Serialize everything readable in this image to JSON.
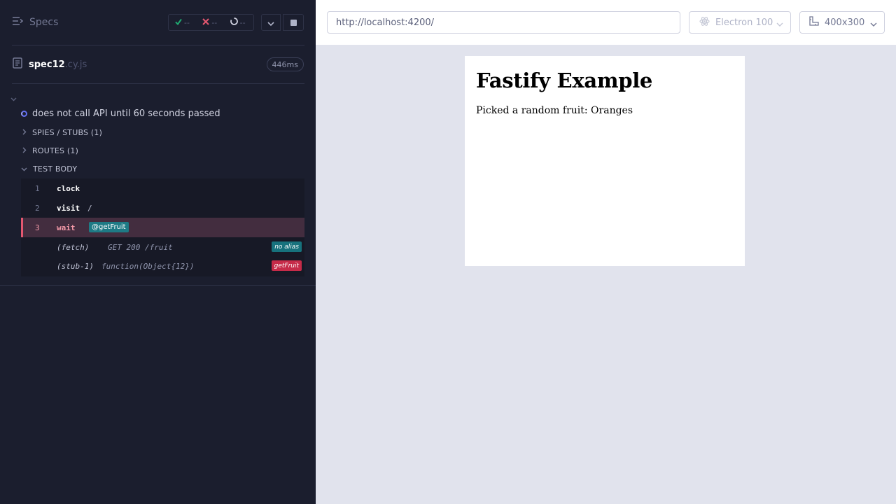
{
  "reporter": {
    "specs_label": "Specs",
    "stats": {
      "passed": "--",
      "failed": "--",
      "pending": "--"
    },
    "spec": {
      "name": "spec12",
      "ext": ".cy.js",
      "duration": "446ms"
    },
    "test": {
      "title": "does not call API until 60 seconds passed"
    },
    "sections": {
      "spies": "SPIES / STUBS (1)",
      "routes": "ROUTES (1)",
      "body": "TEST BODY"
    },
    "commands": [
      {
        "num": "1",
        "name": "clock",
        "message": ""
      },
      {
        "num": "2",
        "name": "visit",
        "message": "/"
      },
      {
        "num": "3",
        "name": "wait",
        "alias": "@getFruit"
      }
    ],
    "events": [
      {
        "name": "(fetch)",
        "message": "GET 200 /fruit",
        "badge": "no alias"
      },
      {
        "name": "(stub-1)",
        "message": "function(Object{12})",
        "badge": "getFruit"
      }
    ]
  },
  "aut": {
    "url": "http://localhost:4200/",
    "browser": "Electron 100",
    "viewport": "400x300",
    "page": {
      "heading": "Fastify Example",
      "text": "Picked a random fruit: Oranges"
    }
  },
  "colors": {
    "reporter_bg": "#1b1e2e",
    "pass": "#1fa971",
    "fail": "#e45770",
    "active_bg": "#432d3f",
    "alias_tag": "#1e7a85",
    "stub_badge": "#c62b49",
    "aut_bg": "#e1e3ed"
  }
}
